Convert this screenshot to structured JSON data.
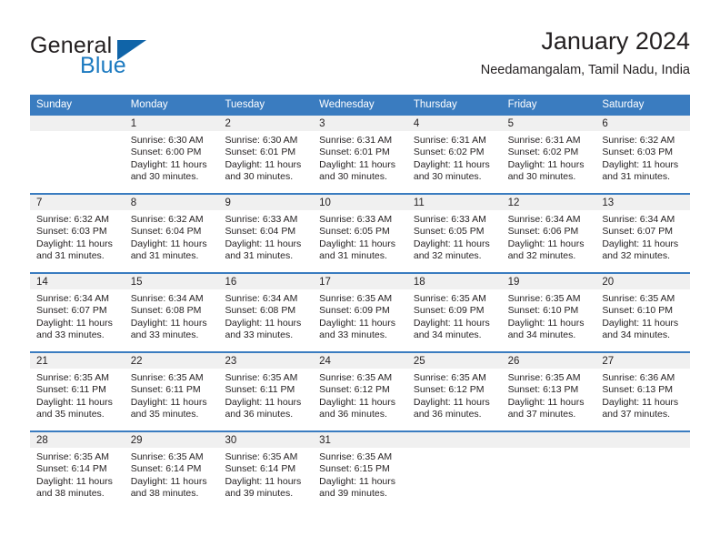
{
  "brand": {
    "name_top": "General",
    "name_bottom": "Blue",
    "color_dark": "#231f20",
    "color_blue": "#1c7ac0",
    "triangle_color": "#1064a8"
  },
  "header": {
    "title": "January 2024",
    "subtitle": "Needamangalam, Tamil Nadu, India"
  },
  "calendar": {
    "header_bg": "#3a7cc0",
    "header_text_color": "#ffffff",
    "daynum_bg": "#f0f0f0",
    "weekdays": [
      "Sunday",
      "Monday",
      "Tuesday",
      "Wednesday",
      "Thursday",
      "Friday",
      "Saturday"
    ],
    "weeks": [
      [
        {
          "day": "",
          "lines": []
        },
        {
          "day": "1",
          "lines": [
            "Sunrise: 6:30 AM",
            "Sunset: 6:00 PM",
            "Daylight: 11 hours",
            "and 30 minutes."
          ]
        },
        {
          "day": "2",
          "lines": [
            "Sunrise: 6:30 AM",
            "Sunset: 6:01 PM",
            "Daylight: 11 hours",
            "and 30 minutes."
          ]
        },
        {
          "day": "3",
          "lines": [
            "Sunrise: 6:31 AM",
            "Sunset: 6:01 PM",
            "Daylight: 11 hours",
            "and 30 minutes."
          ]
        },
        {
          "day": "4",
          "lines": [
            "Sunrise: 6:31 AM",
            "Sunset: 6:02 PM",
            "Daylight: 11 hours",
            "and 30 minutes."
          ]
        },
        {
          "day": "5",
          "lines": [
            "Sunrise: 6:31 AM",
            "Sunset: 6:02 PM",
            "Daylight: 11 hours",
            "and 30 minutes."
          ]
        },
        {
          "day": "6",
          "lines": [
            "Sunrise: 6:32 AM",
            "Sunset: 6:03 PM",
            "Daylight: 11 hours",
            "and 31 minutes."
          ]
        }
      ],
      [
        {
          "day": "7",
          "lines": [
            "Sunrise: 6:32 AM",
            "Sunset: 6:03 PM",
            "Daylight: 11 hours",
            "and 31 minutes."
          ]
        },
        {
          "day": "8",
          "lines": [
            "Sunrise: 6:32 AM",
            "Sunset: 6:04 PM",
            "Daylight: 11 hours",
            "and 31 minutes."
          ]
        },
        {
          "day": "9",
          "lines": [
            "Sunrise: 6:33 AM",
            "Sunset: 6:04 PM",
            "Daylight: 11 hours",
            "and 31 minutes."
          ]
        },
        {
          "day": "10",
          "lines": [
            "Sunrise: 6:33 AM",
            "Sunset: 6:05 PM",
            "Daylight: 11 hours",
            "and 31 minutes."
          ]
        },
        {
          "day": "11",
          "lines": [
            "Sunrise: 6:33 AM",
            "Sunset: 6:05 PM",
            "Daylight: 11 hours",
            "and 32 minutes."
          ]
        },
        {
          "day": "12",
          "lines": [
            "Sunrise: 6:34 AM",
            "Sunset: 6:06 PM",
            "Daylight: 11 hours",
            "and 32 minutes."
          ]
        },
        {
          "day": "13",
          "lines": [
            "Sunrise: 6:34 AM",
            "Sunset: 6:07 PM",
            "Daylight: 11 hours",
            "and 32 minutes."
          ]
        }
      ],
      [
        {
          "day": "14",
          "lines": [
            "Sunrise: 6:34 AM",
            "Sunset: 6:07 PM",
            "Daylight: 11 hours",
            "and 33 minutes."
          ]
        },
        {
          "day": "15",
          "lines": [
            "Sunrise: 6:34 AM",
            "Sunset: 6:08 PM",
            "Daylight: 11 hours",
            "and 33 minutes."
          ]
        },
        {
          "day": "16",
          "lines": [
            "Sunrise: 6:34 AM",
            "Sunset: 6:08 PM",
            "Daylight: 11 hours",
            "and 33 minutes."
          ]
        },
        {
          "day": "17",
          "lines": [
            "Sunrise: 6:35 AM",
            "Sunset: 6:09 PM",
            "Daylight: 11 hours",
            "and 33 minutes."
          ]
        },
        {
          "day": "18",
          "lines": [
            "Sunrise: 6:35 AM",
            "Sunset: 6:09 PM",
            "Daylight: 11 hours",
            "and 34 minutes."
          ]
        },
        {
          "day": "19",
          "lines": [
            "Sunrise: 6:35 AM",
            "Sunset: 6:10 PM",
            "Daylight: 11 hours",
            "and 34 minutes."
          ]
        },
        {
          "day": "20",
          "lines": [
            "Sunrise: 6:35 AM",
            "Sunset: 6:10 PM",
            "Daylight: 11 hours",
            "and 34 minutes."
          ]
        }
      ],
      [
        {
          "day": "21",
          "lines": [
            "Sunrise: 6:35 AM",
            "Sunset: 6:11 PM",
            "Daylight: 11 hours",
            "and 35 minutes."
          ]
        },
        {
          "day": "22",
          "lines": [
            "Sunrise: 6:35 AM",
            "Sunset: 6:11 PM",
            "Daylight: 11 hours",
            "and 35 minutes."
          ]
        },
        {
          "day": "23",
          "lines": [
            "Sunrise: 6:35 AM",
            "Sunset: 6:11 PM",
            "Daylight: 11 hours",
            "and 36 minutes."
          ]
        },
        {
          "day": "24",
          "lines": [
            "Sunrise: 6:35 AM",
            "Sunset: 6:12 PM",
            "Daylight: 11 hours",
            "and 36 minutes."
          ]
        },
        {
          "day": "25",
          "lines": [
            "Sunrise: 6:35 AM",
            "Sunset: 6:12 PM",
            "Daylight: 11 hours",
            "and 36 minutes."
          ]
        },
        {
          "day": "26",
          "lines": [
            "Sunrise: 6:35 AM",
            "Sunset: 6:13 PM",
            "Daylight: 11 hours",
            "and 37 minutes."
          ]
        },
        {
          "day": "27",
          "lines": [
            "Sunrise: 6:36 AM",
            "Sunset: 6:13 PM",
            "Daylight: 11 hours",
            "and 37 minutes."
          ]
        }
      ],
      [
        {
          "day": "28",
          "lines": [
            "Sunrise: 6:35 AM",
            "Sunset: 6:14 PM",
            "Daylight: 11 hours",
            "and 38 minutes."
          ]
        },
        {
          "day": "29",
          "lines": [
            "Sunrise: 6:35 AM",
            "Sunset: 6:14 PM",
            "Daylight: 11 hours",
            "and 38 minutes."
          ]
        },
        {
          "day": "30",
          "lines": [
            "Sunrise: 6:35 AM",
            "Sunset: 6:14 PM",
            "Daylight: 11 hours",
            "and 39 minutes."
          ]
        },
        {
          "day": "31",
          "lines": [
            "Sunrise: 6:35 AM",
            "Sunset: 6:15 PM",
            "Daylight: 11 hours",
            "and 39 minutes."
          ]
        },
        {
          "day": "",
          "lines": []
        },
        {
          "day": "",
          "lines": []
        },
        {
          "day": "",
          "lines": []
        }
      ]
    ]
  }
}
